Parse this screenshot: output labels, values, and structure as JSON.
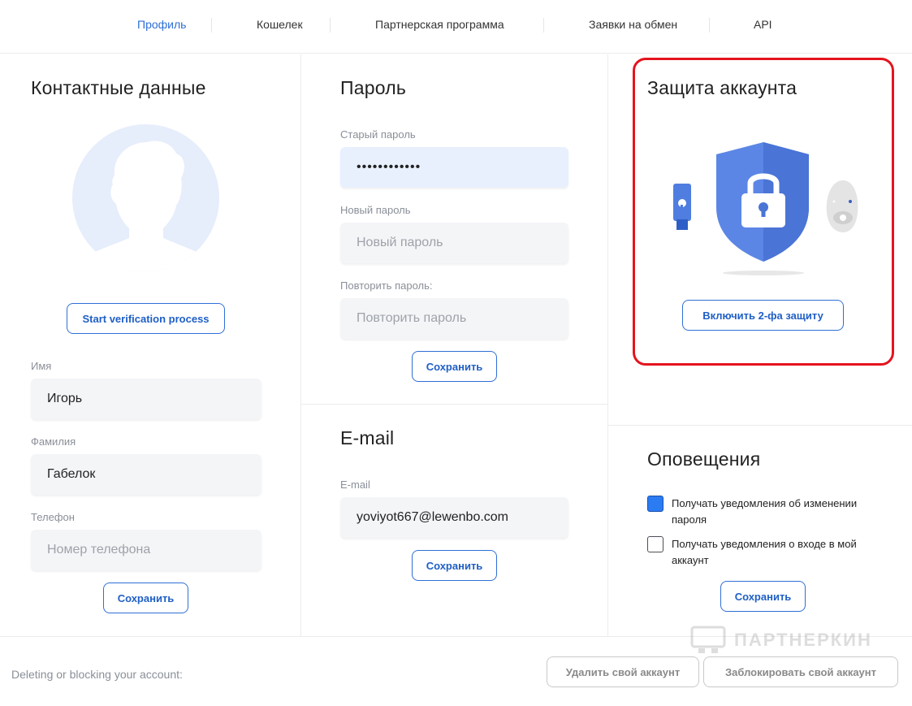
{
  "nav": {
    "tabs": [
      {
        "label": "Профиль",
        "active": true
      },
      {
        "label": "Кошелек",
        "active": false
      },
      {
        "label": "Партнерская программа",
        "active": false
      },
      {
        "label": "Заявки на обмен",
        "active": false
      },
      {
        "label": "API",
        "active": false
      }
    ]
  },
  "contact": {
    "title": "Контактные данные",
    "verify_button": "Start verification process",
    "first_name": {
      "label": "Имя",
      "value": "Игорь"
    },
    "last_name": {
      "label": "Фамилия",
      "value": "Габелок"
    },
    "phone": {
      "label": "Телефон",
      "placeholder": "Номер телефона"
    },
    "save_button": "Сохранить"
  },
  "password": {
    "title": "Пароль",
    "old": {
      "label": "Старый пароль",
      "value": "••••••••••••"
    },
    "new": {
      "label": "Новый пароль",
      "placeholder": "Новый пароль"
    },
    "repeat": {
      "label": "Повторить пароль:",
      "placeholder": "Повторить пароль"
    },
    "save_button": "Сохранить"
  },
  "email": {
    "title": "E-mail",
    "field": {
      "label": "E-mail",
      "value": "yoviyot667@lewenbo.com"
    },
    "save_button": "Сохранить"
  },
  "security": {
    "title": "Защита аккаунта",
    "enable_2fa_button": "Включить 2-фа защиту",
    "highlight_color": "#e4141e",
    "shield_color": "#5b86e5"
  },
  "notifications": {
    "title": "Оповещения",
    "options": [
      {
        "label": "Получать уведомления об изменении пароля",
        "checked": true
      },
      {
        "label": "Получать уведомления о входе в мой аккаунт",
        "checked": false
      }
    ],
    "save_button": "Сохранить"
  },
  "footer": {
    "text": "Deleting or blocking your account:",
    "delete_button": "Удалить свой аккаунт",
    "block_button": "Заблокировать свой аккаунт"
  },
  "watermark": {
    "text": "ПАРТНЕРКИН"
  },
  "colors": {
    "accent": "#2f6fd6",
    "input_bg": "#f4f5f7"
  }
}
